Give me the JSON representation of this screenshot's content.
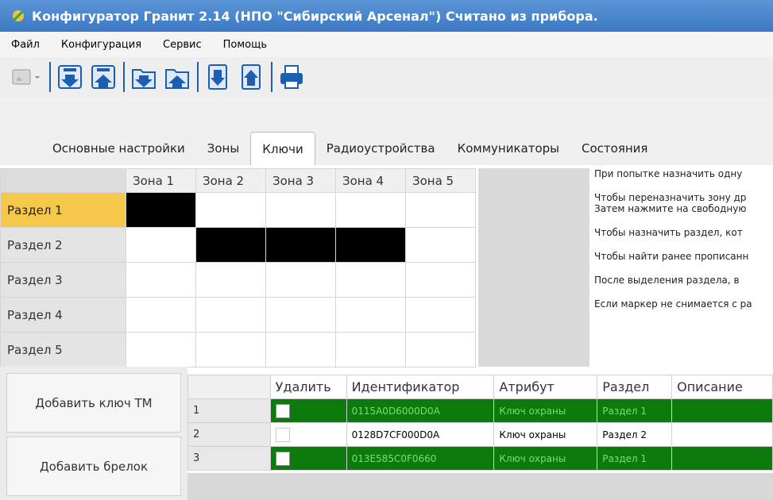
{
  "title": "Конфигуратор Гранит 2.14 (НПО \"Сибирский Арсенал\")   Считано из прибора.",
  "menu": [
    "Файл",
    "Конфигурация",
    "Сервис",
    "Помощь"
  ],
  "tabs": [
    "Основные настройки",
    "Зоны",
    "Ключи",
    "Радиоустройства",
    "Коммуникаторы",
    "Состояния"
  ],
  "active_tab": 2,
  "grid": {
    "columns": [
      "Зона 1",
      "Зона 2",
      "Зона 3",
      "Зона 4",
      "Зона 5"
    ],
    "rows": [
      {
        "label": "Раздел 1",
        "cells": [
          1,
          0,
          0,
          0,
          0
        ]
      },
      {
        "label": "Раздел 2",
        "cells": [
          0,
          1,
          1,
          1,
          0
        ]
      },
      {
        "label": "Раздел 3",
        "cells": [
          0,
          0,
          0,
          0,
          0
        ]
      },
      {
        "label": "Раздел 4",
        "cells": [
          0,
          0,
          0,
          0,
          0
        ]
      },
      {
        "label": "Раздел 5",
        "cells": [
          0,
          0,
          0,
          0,
          0
        ]
      }
    ]
  },
  "instructions": [
    "При попытке назначить одну",
    "Чтобы переназначить зону др",
    "Затем нажмите на свободную",
    "Чтобы назначить раздел, кот",
    "Чтобы найти ранее прописанн",
    "После выделения раздела, в",
    "Если маркер не снимается с ра"
  ],
  "buttons": {
    "add_tm": "Добавить ключ ТМ",
    "add_fob": "Добавить брелок"
  },
  "keys": {
    "headers": [
      "Удалить",
      "Идентификатор",
      "Атрибут",
      "Раздел",
      "Описание"
    ],
    "rows": [
      {
        "num": "1",
        "id": "0115A0D6000D0A",
        "attr": "Ключ охраны",
        "section": "Раздел 1",
        "highlight": true
      },
      {
        "num": "2",
        "id": "0128D7CF000D0A",
        "attr": "Ключ охраны",
        "section": "Раздел 2",
        "highlight": false
      },
      {
        "num": "3",
        "id": "013E585C0F0660",
        "attr": "Ключ охраны",
        "section": "Раздел 1",
        "highlight": true
      }
    ]
  }
}
